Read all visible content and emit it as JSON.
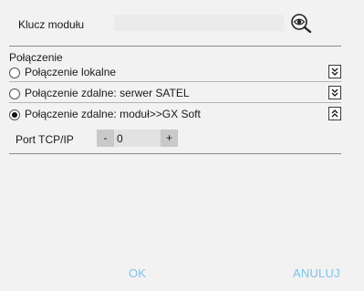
{
  "module_key": {
    "label": "Klucz modułu",
    "value": ""
  },
  "connection": {
    "section_title": "Połączenie",
    "options": [
      {
        "label": "Połączenie lokalne",
        "selected": false,
        "expanded": false
      },
      {
        "label": "Połączenie zdalne: serwer SATEL",
        "selected": false,
        "expanded": false
      },
      {
        "label": "Połączenie zdalne: moduł>>GX Soft",
        "selected": true,
        "expanded": true
      }
    ]
  },
  "port": {
    "label": "Port TCP/IP",
    "decrement_label": "-",
    "value": "0",
    "increment_label": "+"
  },
  "footer": {
    "ok_label": "OK",
    "cancel_label": "ANULUJ"
  },
  "icons": {
    "show_key": "eye-magnifier-icon",
    "expand": "chevron-double-down-icon",
    "collapse": "chevron-double-up-icon"
  },
  "colors": {
    "background": "#f2f2f2",
    "footer_text": "#7ec3ea",
    "rule": "#8a8a8a"
  }
}
